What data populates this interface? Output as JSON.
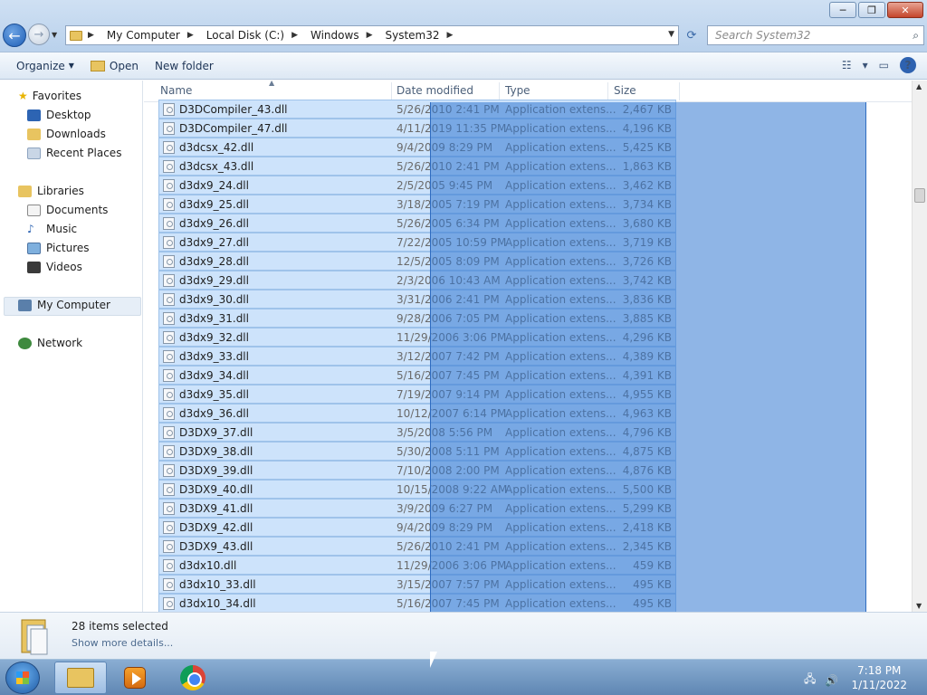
{
  "window": {
    "minimize_label": "─",
    "restore_label": "❐",
    "close_label": "✕"
  },
  "address": {
    "crumbs": [
      "My Computer",
      "Local Disk (C:)",
      "Windows",
      "System32"
    ],
    "search_placeholder": "Search System32"
  },
  "toolbar": {
    "organize_label": "Organize",
    "open_label": "Open",
    "new_folder_label": "New folder"
  },
  "nav": {
    "favorites": "Favorites",
    "desktop": "Desktop",
    "downloads": "Downloads",
    "recent_places": "Recent Places",
    "libraries": "Libraries",
    "documents": "Documents",
    "music": "Music",
    "pictures": "Pictures",
    "videos": "Videos",
    "my_computer": "My Computer",
    "network": "Network"
  },
  "columns": {
    "name": "Name",
    "date_modified": "Date modified",
    "type": "Type",
    "size": "Size"
  },
  "files": [
    {
      "name": "D3DCompiler_43.dll",
      "date": "5/26/2010 2:41 PM",
      "type": "Application extens...",
      "size": "2,467 KB"
    },
    {
      "name": "D3DCompiler_47.dll",
      "date": "4/11/2019 11:35 PM",
      "type": "Application extens...",
      "size": "4,196 KB"
    },
    {
      "name": "d3dcsx_42.dll",
      "date": "9/4/2009 8:29 PM",
      "type": "Application extens...",
      "size": "5,425 KB"
    },
    {
      "name": "d3dcsx_43.dll",
      "date": "5/26/2010 2:41 PM",
      "type": "Application extens...",
      "size": "1,863 KB"
    },
    {
      "name": "d3dx9_24.dll",
      "date": "2/5/2005 9:45 PM",
      "type": "Application extens...",
      "size": "3,462 KB"
    },
    {
      "name": "d3dx9_25.dll",
      "date": "3/18/2005 7:19 PM",
      "type": "Application extens...",
      "size": "3,734 KB"
    },
    {
      "name": "d3dx9_26.dll",
      "date": "5/26/2005 6:34 PM",
      "type": "Application extens...",
      "size": "3,680 KB"
    },
    {
      "name": "d3dx9_27.dll",
      "date": "7/22/2005 10:59 PM",
      "type": "Application extens...",
      "size": "3,719 KB"
    },
    {
      "name": "d3dx9_28.dll",
      "date": "12/5/2005 8:09 PM",
      "type": "Application extens...",
      "size": "3,726 KB"
    },
    {
      "name": "d3dx9_29.dll",
      "date": "2/3/2006 10:43 AM",
      "type": "Application extens...",
      "size": "3,742 KB"
    },
    {
      "name": "d3dx9_30.dll",
      "date": "3/31/2006 2:41 PM",
      "type": "Application extens...",
      "size": "3,836 KB"
    },
    {
      "name": "d3dx9_31.dll",
      "date": "9/28/2006 7:05 PM",
      "type": "Application extens...",
      "size": "3,885 KB"
    },
    {
      "name": "d3dx9_32.dll",
      "date": "11/29/2006 3:06 PM",
      "type": "Application extens...",
      "size": "4,296 KB"
    },
    {
      "name": "d3dx9_33.dll",
      "date": "3/12/2007 7:42 PM",
      "type": "Application extens...",
      "size": "4,389 KB"
    },
    {
      "name": "d3dx9_34.dll",
      "date": "5/16/2007 7:45 PM",
      "type": "Application extens...",
      "size": "4,391 KB"
    },
    {
      "name": "d3dx9_35.dll",
      "date": "7/19/2007 9:14 PM",
      "type": "Application extens...",
      "size": "4,955 KB"
    },
    {
      "name": "d3dx9_36.dll",
      "date": "10/12/2007 6:14 PM",
      "type": "Application extens...",
      "size": "4,963 KB"
    },
    {
      "name": "D3DX9_37.dll",
      "date": "3/5/2008 5:56 PM",
      "type": "Application extens...",
      "size": "4,796 KB"
    },
    {
      "name": "D3DX9_38.dll",
      "date": "5/30/2008 5:11 PM",
      "type": "Application extens...",
      "size": "4,875 KB"
    },
    {
      "name": "D3DX9_39.dll",
      "date": "7/10/2008 2:00 PM",
      "type": "Application extens...",
      "size": "4,876 KB"
    },
    {
      "name": "D3DX9_40.dll",
      "date": "10/15/2008 9:22 AM",
      "type": "Application extens...",
      "size": "5,500 KB"
    },
    {
      "name": "D3DX9_41.dll",
      "date": "3/9/2009 6:27 PM",
      "type": "Application extens...",
      "size": "5,299 KB"
    },
    {
      "name": "D3DX9_42.dll",
      "date": "9/4/2009 8:29 PM",
      "type": "Application extens...",
      "size": "2,418 KB"
    },
    {
      "name": "D3DX9_43.dll",
      "date": "5/26/2010 2:41 PM",
      "type": "Application extens...",
      "size": "2,345 KB"
    },
    {
      "name": "d3dx10.dll",
      "date": "11/29/2006 3:06 PM",
      "type": "Application extens...",
      "size": "459 KB"
    },
    {
      "name": "d3dx10_33.dll",
      "date": "3/15/2007 7:57 PM",
      "type": "Application extens...",
      "size": "495 KB"
    },
    {
      "name": "d3dx10_34.dll",
      "date": "5/16/2007 7:45 PM",
      "type": "Application extens...",
      "size": "495 KB"
    }
  ],
  "details": {
    "selected_count": "28 items selected",
    "show_more": "Show more details..."
  },
  "taskbar": {
    "time": "7:18 PM",
    "date": "1/11/2022"
  },
  "colors": {
    "selection_fill": "#cde3fb",
    "marquee": "#3378d2",
    "taskbar": "#5f86b3"
  }
}
